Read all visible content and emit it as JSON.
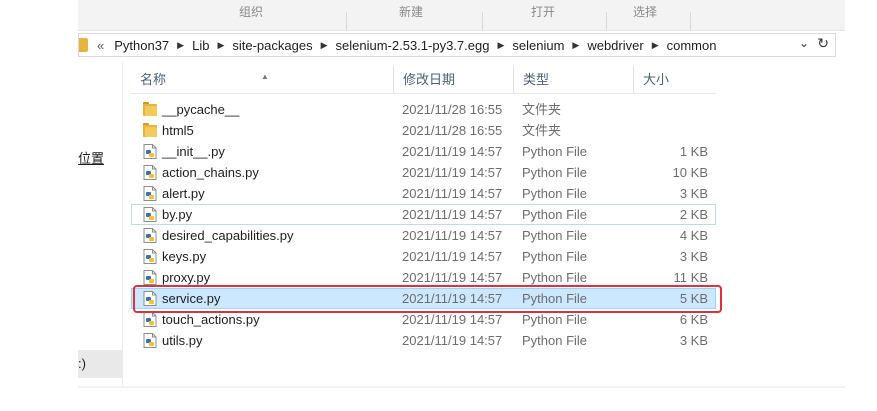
{
  "ribbon": {
    "groups": [
      "组织",
      "新建",
      "打开",
      "选择"
    ]
  },
  "address": {
    "overflow": "«",
    "crumbs": [
      "Python37",
      "Lib",
      "site-packages",
      "selenium-2.53.1-py3.7.egg",
      "selenium",
      "webdriver",
      "common"
    ],
    "dropdown_icon": "chevron-down-icon",
    "refresh_icon": "refresh-icon"
  },
  "nav": {
    "item1": "位置",
    "item2": ":)"
  },
  "columns": {
    "name": "名称",
    "date": "修改日期",
    "type": "类型",
    "size": "大小"
  },
  "files": [
    {
      "name": "__pycache__",
      "date": "2021/11/28 16:55",
      "type": "文件夹",
      "size": "",
      "icon": "folder-icon"
    },
    {
      "name": "html5",
      "date": "2021/11/28 16:55",
      "type": "文件夹",
      "size": "",
      "icon": "folder-icon"
    },
    {
      "name": "__init__.py",
      "date": "2021/11/19 14:57",
      "type": "Python File",
      "size": "1 KB",
      "icon": "python-file-icon"
    },
    {
      "name": "action_chains.py",
      "date": "2021/11/19 14:57",
      "type": "Python File",
      "size": "10 KB",
      "icon": "python-file-icon"
    },
    {
      "name": "alert.py",
      "date": "2021/11/19 14:57",
      "type": "Python File",
      "size": "3 KB",
      "icon": "python-file-icon"
    },
    {
      "name": "by.py",
      "date": "2021/11/19 14:57",
      "type": "Python File",
      "size": "2 KB",
      "icon": "python-file-icon"
    },
    {
      "name": "desired_capabilities.py",
      "date": "2021/11/19 14:57",
      "type": "Python File",
      "size": "4 KB",
      "icon": "python-file-icon"
    },
    {
      "name": "keys.py",
      "date": "2021/11/19 14:57",
      "type": "Python File",
      "size": "3 KB",
      "icon": "python-file-icon"
    },
    {
      "name": "proxy.py",
      "date": "2021/11/19 14:57",
      "type": "Python File",
      "size": "11 KB",
      "icon": "python-file-icon"
    },
    {
      "name": "service.py",
      "date": "2021/11/19 14:57",
      "type": "Python File",
      "size": "5 KB",
      "icon": "python-file-icon"
    },
    {
      "name": "touch_actions.py",
      "date": "2021/11/19 14:57",
      "type": "Python File",
      "size": "6 KB",
      "icon": "python-file-icon"
    },
    {
      "name": "utils.py",
      "date": "2021/11/19 14:57",
      "type": "Python File",
      "size": "3 KB",
      "icon": "python-file-icon"
    }
  ],
  "colors": {
    "selection": "#cce8ff",
    "highlight_box": "#e0303a",
    "folder": "#e8b440"
  }
}
